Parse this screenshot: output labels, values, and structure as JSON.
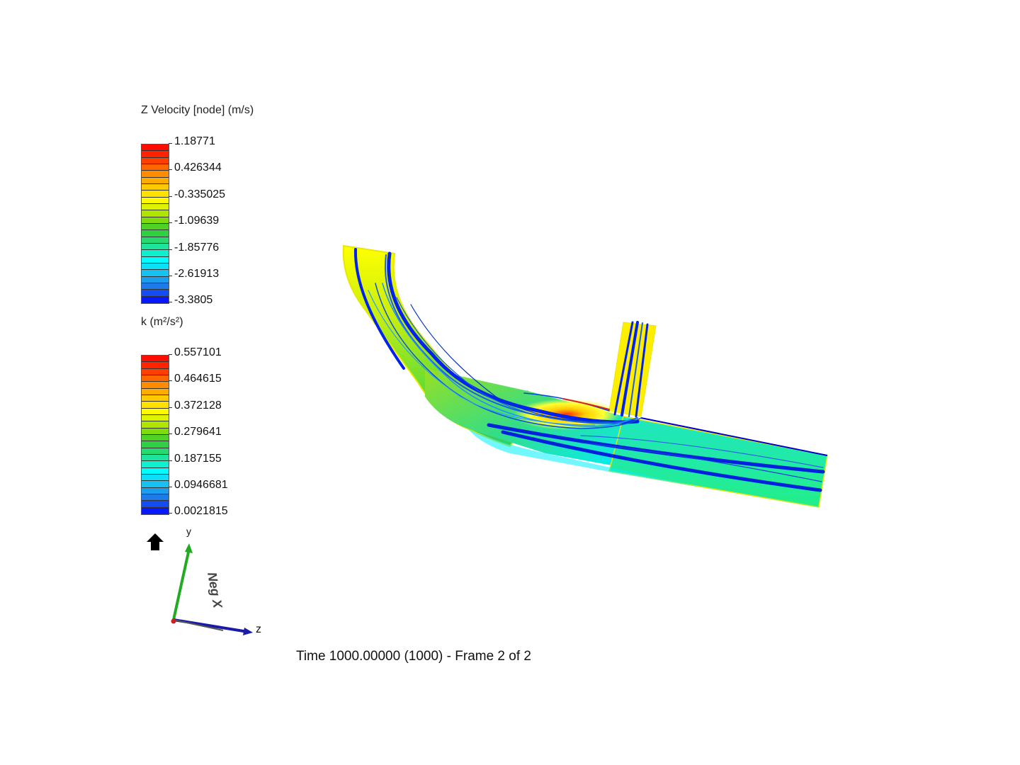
{
  "legends": [
    {
      "title": "Z Velocity [node] (m/s)",
      "ticks": [
        "1.18771",
        "0.426344",
        "-0.335025",
        "-1.09639",
        "-1.85776",
        "-2.61913",
        "-3.3805"
      ],
      "min": -3.3805,
      "max": 1.18771,
      "bands": 24
    },
    {
      "title": "k (m²/s²)",
      "ticks": [
        "0.557101",
        "0.464615",
        "0.372128",
        "0.279641",
        "0.187155",
        "0.0946681",
        "0.0021815"
      ],
      "min": 0.0021815,
      "max": 0.557101,
      "bands": 24
    }
  ],
  "triad": {
    "z_label": "z",
    "y_label": "y",
    "view_label": "Neg X",
    "y_color": "#22aa22",
    "z_color": "#1a1aa8",
    "origin_color": "#cc2222"
  },
  "status": "Time 1000.00000 (1000) - Frame 2 of 2",
  "colormap": [
    "#0000ff",
    "#1e6fe8",
    "#18bdf0",
    "#00ffff",
    "#22e090",
    "#33cc33",
    "#9be000",
    "#ffff00",
    "#ffcc00",
    "#ff8800",
    "#ff3300",
    "#ff0000"
  ]
}
